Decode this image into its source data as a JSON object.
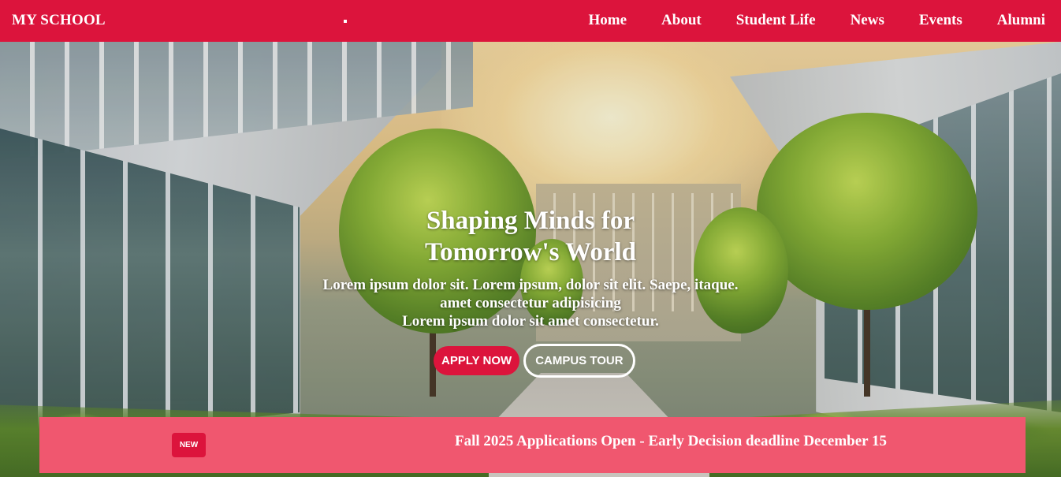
{
  "navbar": {
    "brand": "MY SCHOOL",
    "links": [
      {
        "label": "Home"
      },
      {
        "label": "About"
      },
      {
        "label": "Student Life"
      },
      {
        "label": "News"
      },
      {
        "label": "Events"
      },
      {
        "label": "Alumni"
      }
    ],
    "background_color": "#dc143c"
  },
  "hero": {
    "title_line1": "Shaping Minds for",
    "title_line2": "Tomorrow's World",
    "subtitle_line1": "Lorem ipsum dolor sit. Lorem ipsum, dolor sit elit. Saepe, itaque.",
    "subtitle_line2": "amet consectetur adipisicing",
    "subtitle_line3": "Lorem ipsum dolor sit amet consectetur.",
    "apply_button": "APPLY NOW",
    "tour_button": "CAMPUS TOUR"
  },
  "announcement": {
    "badge": "NEW",
    "text": "Fall 2025 Applications Open - Early Decision deadline December 15",
    "background_color": "#f0576f",
    "badge_color": "#dc143c"
  }
}
